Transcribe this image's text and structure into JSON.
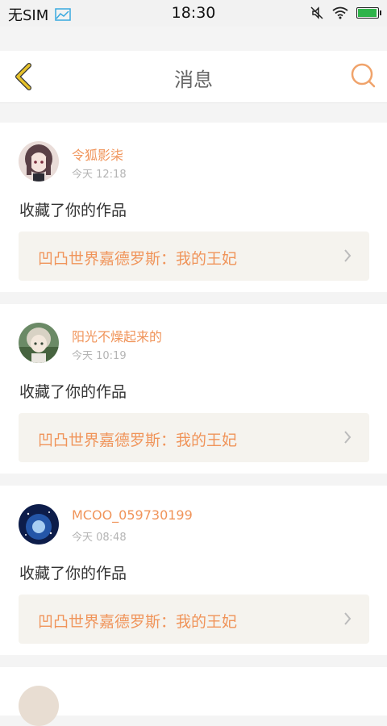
{
  "status_bar": {
    "carrier": "无SIM",
    "time": "18:30",
    "battery_level": 1.0
  },
  "header": {
    "title": "消息"
  },
  "colors": {
    "accent": "#f0945a",
    "back_yellow": "#e6c22b",
    "card_link_bg": "#f5f3ee"
  },
  "messages": [
    {
      "username": "令狐影柒",
      "time": "今天 12:18",
      "action": "收藏了你的作品",
      "work_title": "凹凸世界嘉德罗斯：我的王妃",
      "avatar_icon": "anime-girl-avatar"
    },
    {
      "username": "阳光不燥起来的",
      "time": "今天 10:19",
      "action": "收藏了你的作品",
      "work_title": "凹凸世界嘉德罗斯：我的王妃",
      "avatar_icon": "anime-boy-avatar"
    },
    {
      "username": "MCOO_059730199",
      "time": "今天 08:48",
      "action": "收藏了你的作品",
      "work_title": "凹凸世界嘉德罗斯：我的王妃",
      "avatar_icon": "blue-galaxy-avatar"
    }
  ]
}
